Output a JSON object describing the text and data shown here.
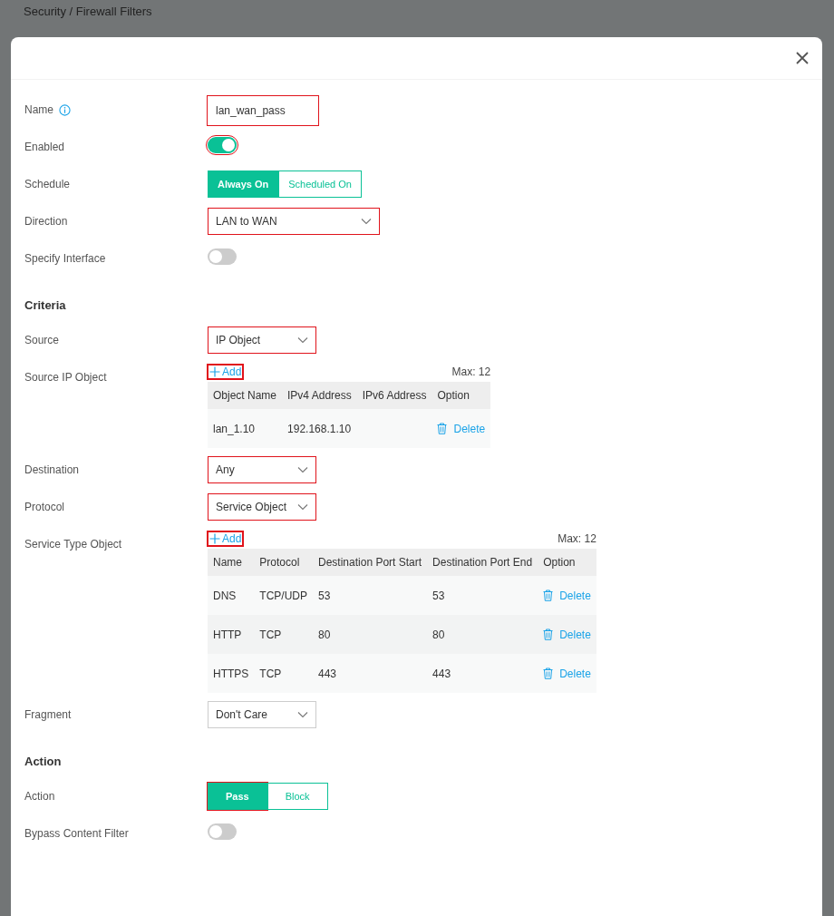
{
  "breadcrumb": "Security / Firewall Filters",
  "rows": [
    {
      "kind": "text",
      "label": "Name",
      "info": true,
      "value": "lan_wan_pass",
      "highlighted": true
    },
    {
      "kind": "toggle",
      "label": "Enabled",
      "on": true,
      "highlighted": true
    },
    {
      "kind": "segmented",
      "label": "Schedule",
      "options": [
        {
          "label": "Always On",
          "selected": true,
          "highlighted": false
        },
        {
          "label": "Scheduled On",
          "selected": false,
          "highlighted": false
        }
      ]
    },
    {
      "kind": "wide_select",
      "label": "Direction",
      "value": "LAN to WAN",
      "highlighted": true
    },
    {
      "kind": "toggle",
      "label": "Specify Interface",
      "on": false,
      "highlighted": false
    },
    {
      "kind": "heading",
      "label": "Criteria"
    },
    {
      "kind": "select",
      "label": "Source",
      "value": "IP Object",
      "highlighted": true
    },
    {
      "kind": "object_table",
      "label": "Source IP Object",
      "add": "Add",
      "add_highlighted": true,
      "max": "Max: 12",
      "columns": [
        "Object Name",
        "IPv4 Address",
        "IPv6 Address",
        "Option"
      ],
      "rows": [
        {
          "cells": [
            "lan_1.10",
            "192.168.1.10",
            ""
          ],
          "action": "Delete"
        }
      ]
    },
    {
      "kind": "select",
      "label": "Destination",
      "value": "Any",
      "highlighted": true
    },
    {
      "kind": "select",
      "label": "Protocol",
      "value": "Service Object",
      "highlighted": true
    },
    {
      "kind": "object_table",
      "label": "Service Type Object",
      "add": "Add",
      "add_highlighted": true,
      "max": "Max: 12",
      "columns": [
        "Name",
        "Protocol",
        "Destination Port Start",
        "Destination Port End",
        "Option"
      ],
      "rows": [
        {
          "cells": [
            "DNS",
            "TCP/UDP",
            "53",
            "53"
          ],
          "action": "Delete"
        },
        {
          "cells": [
            "HTTP",
            "TCP",
            "80",
            "80"
          ],
          "action": "Delete"
        },
        {
          "cells": [
            "HTTPS",
            "TCP",
            "443",
            "443"
          ],
          "action": "Delete"
        }
      ]
    },
    {
      "kind": "select",
      "label": "Fragment",
      "value": "Don't Care",
      "highlighted": false
    },
    {
      "kind": "heading",
      "label": "Action"
    },
    {
      "kind": "segmented",
      "label": "Action",
      "options": [
        {
          "label": "Pass",
          "selected": true,
          "highlighted": true
        },
        {
          "label": "Block",
          "selected": false,
          "highlighted": false
        }
      ]
    },
    {
      "kind": "toggle",
      "label": "Bypass Content Filter",
      "on": false,
      "highlighted": false
    }
  ]
}
